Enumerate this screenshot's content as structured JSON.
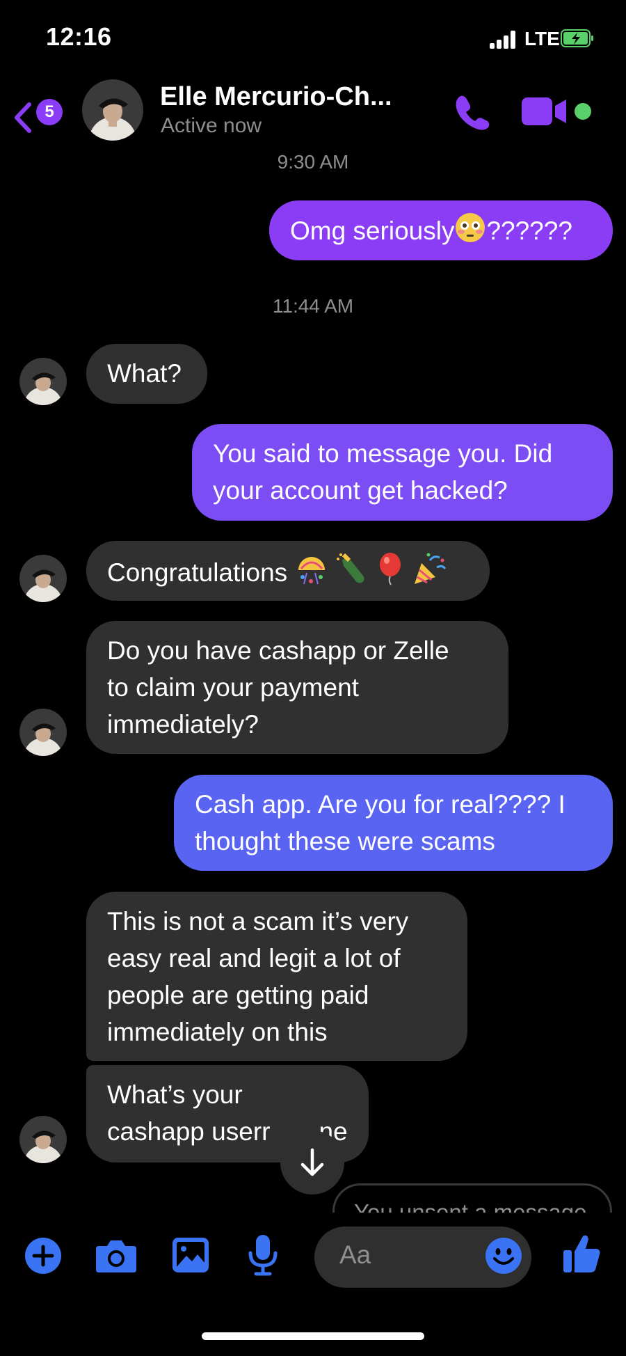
{
  "status_bar": {
    "time": "12:16",
    "network": "LTE"
  },
  "header": {
    "back_badge": "5",
    "contact_name": "Elle Mercurio-Ch...",
    "contact_status": "Active now"
  },
  "timestamps": [
    "9:30 AM",
    "11:44 AM"
  ],
  "messages": [
    {
      "from": "me",
      "text": "Omg seriously",
      "emoji": "flushed-face",
      "suffix": "??????"
    },
    {
      "from": "contact",
      "text": "What?"
    },
    {
      "from": "me",
      "lines": [
        "You said to message you. Did",
        "your account get hacked?"
      ]
    },
    {
      "from": "contact",
      "text": "Congratulations",
      "emoji": [
        "confetti-ball",
        "champagne-bottle",
        "red-balloon",
        "party-popper"
      ]
    },
    {
      "from": "contact",
      "lines": [
        "Do you have cashapp or Zelle",
        "to claim your payment",
        "immediately?"
      ]
    },
    {
      "from": "me",
      "lines": [
        "Cash app. Are you for real???? I",
        "thought these were scams"
      ]
    },
    {
      "from": "contact",
      "lines": [
        "This is not a scam it’s very",
        "easy real and legit a lot of",
        "people are getting paid",
        "immediately on this"
      ]
    },
    {
      "from": "contact",
      "lines": [
        "What’s your",
        "cashapp userr"
      ],
      "tail": "ne"
    }
  ],
  "unsent_notice": "You unsent a message",
  "composer": {
    "placeholder": "Aa"
  },
  "colors": {
    "accent": "#8a3df5",
    "icon_blue": "#3a74f5",
    "incoming_bubble": "#303030",
    "online": "#5ad06a"
  },
  "icons": [
    "back-chevron-icon",
    "phone-icon",
    "video-camera-icon",
    "plus-icon",
    "camera-icon",
    "photo-icon",
    "microphone-icon",
    "smiley-icon",
    "thumbs-up-icon",
    "arrow-down-icon"
  ]
}
